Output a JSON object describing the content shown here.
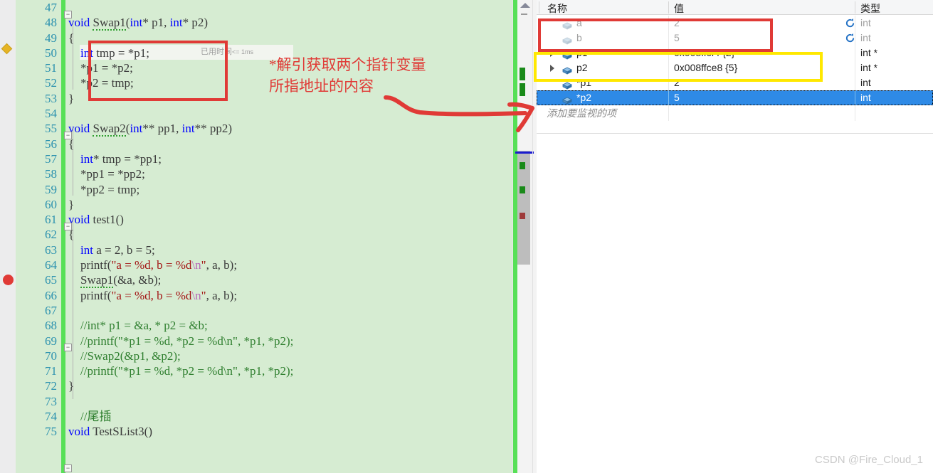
{
  "editor": {
    "first_line_number": 47,
    "inline_hint": "已用时间",
    "inline_hint_ms": "<= 1ms",
    "gutter": {
      "breakpoint_line": 64,
      "bookmark_line": 50
    },
    "lines": [
      {
        "n": 47,
        "text": ""
      },
      {
        "n": 48,
        "text": "void Swap1(int* p1, int* p2)"
      },
      {
        "n": 49,
        "text": "{"
      },
      {
        "n": 50,
        "text": "    int tmp = *p1;"
      },
      {
        "n": 51,
        "text": "    *p1 = *p2;"
      },
      {
        "n": 52,
        "text": "    *p2 = tmp;"
      },
      {
        "n": 53,
        "text": "}"
      },
      {
        "n": 54,
        "text": ""
      },
      {
        "n": 55,
        "text": "void Swap2(int** pp1, int** pp2)"
      },
      {
        "n": 56,
        "text": "{"
      },
      {
        "n": 57,
        "text": "    int* tmp = *pp1;"
      },
      {
        "n": 58,
        "text": "    *pp1 = *pp2;"
      },
      {
        "n": 59,
        "text": "    *pp2 = tmp;"
      },
      {
        "n": 60,
        "text": "}"
      },
      {
        "n": 61,
        "text": "void test1()"
      },
      {
        "n": 62,
        "text": "{"
      },
      {
        "n": 63,
        "text": "    int a = 2, b = 5;"
      },
      {
        "n": 64,
        "text": "    printf(\"a = %d, b = %d\\n\", a, b);"
      },
      {
        "n": 65,
        "text": "    Swap1(&a, &b);"
      },
      {
        "n": 66,
        "text": "    printf(\"a = %d, b = %d\\n\", a, b);"
      },
      {
        "n": 67,
        "text": ""
      },
      {
        "n": 68,
        "text": "    //int* p1 = &a, * p2 = &b;"
      },
      {
        "n": 69,
        "text": "    //printf(\"*p1 = %d, *p2 = %d\\n\", *p1, *p2);"
      },
      {
        "n": 70,
        "text": "    //Swap2(&p1, &p2);"
      },
      {
        "n": 71,
        "text": "    //printf(\"*p1 = %d, *p2 = %d\\n\", *p1, *p2);"
      },
      {
        "n": 72,
        "text": "}"
      },
      {
        "n": 73,
        "text": ""
      },
      {
        "n": 74,
        "text": "    //尾插"
      },
      {
        "n": 75,
        "text": "void TestSList3()"
      }
    ]
  },
  "watch": {
    "columns": {
      "name": "名称",
      "value": "值",
      "type": "类型"
    },
    "add_row_placeholder": "添加要监视的项",
    "rows": [
      {
        "name": "a",
        "value": "2",
        "type": "int",
        "expandable": false,
        "dim": true,
        "refresh": true,
        "selected": false
      },
      {
        "name": "b",
        "value": "5",
        "type": "int",
        "expandable": false,
        "dim": true,
        "refresh": true,
        "selected": false
      },
      {
        "name": "p1",
        "value": "0x008ffcf4 {2}",
        "type": "int *",
        "expandable": true,
        "dim": false,
        "refresh": false,
        "selected": false
      },
      {
        "name": "p2",
        "value": "0x008ffce8 {5}",
        "type": "int *",
        "expandable": true,
        "dim": false,
        "refresh": false,
        "selected": false
      },
      {
        "name": "*p1",
        "value": "2",
        "type": "int",
        "expandable": false,
        "dim": false,
        "refresh": false,
        "selected": false
      },
      {
        "name": "*p2",
        "value": "5",
        "type": "int",
        "expandable": false,
        "dim": false,
        "refresh": false,
        "selected": true
      }
    ]
  },
  "annotations": {
    "note_line1": "*解引获取两个指针变量",
    "note_line2": "所指地址的内容",
    "red_color": "#e03a36",
    "yellow_color": "#ffe800"
  },
  "watermark": "CSDN @Fire_Cloud_1"
}
